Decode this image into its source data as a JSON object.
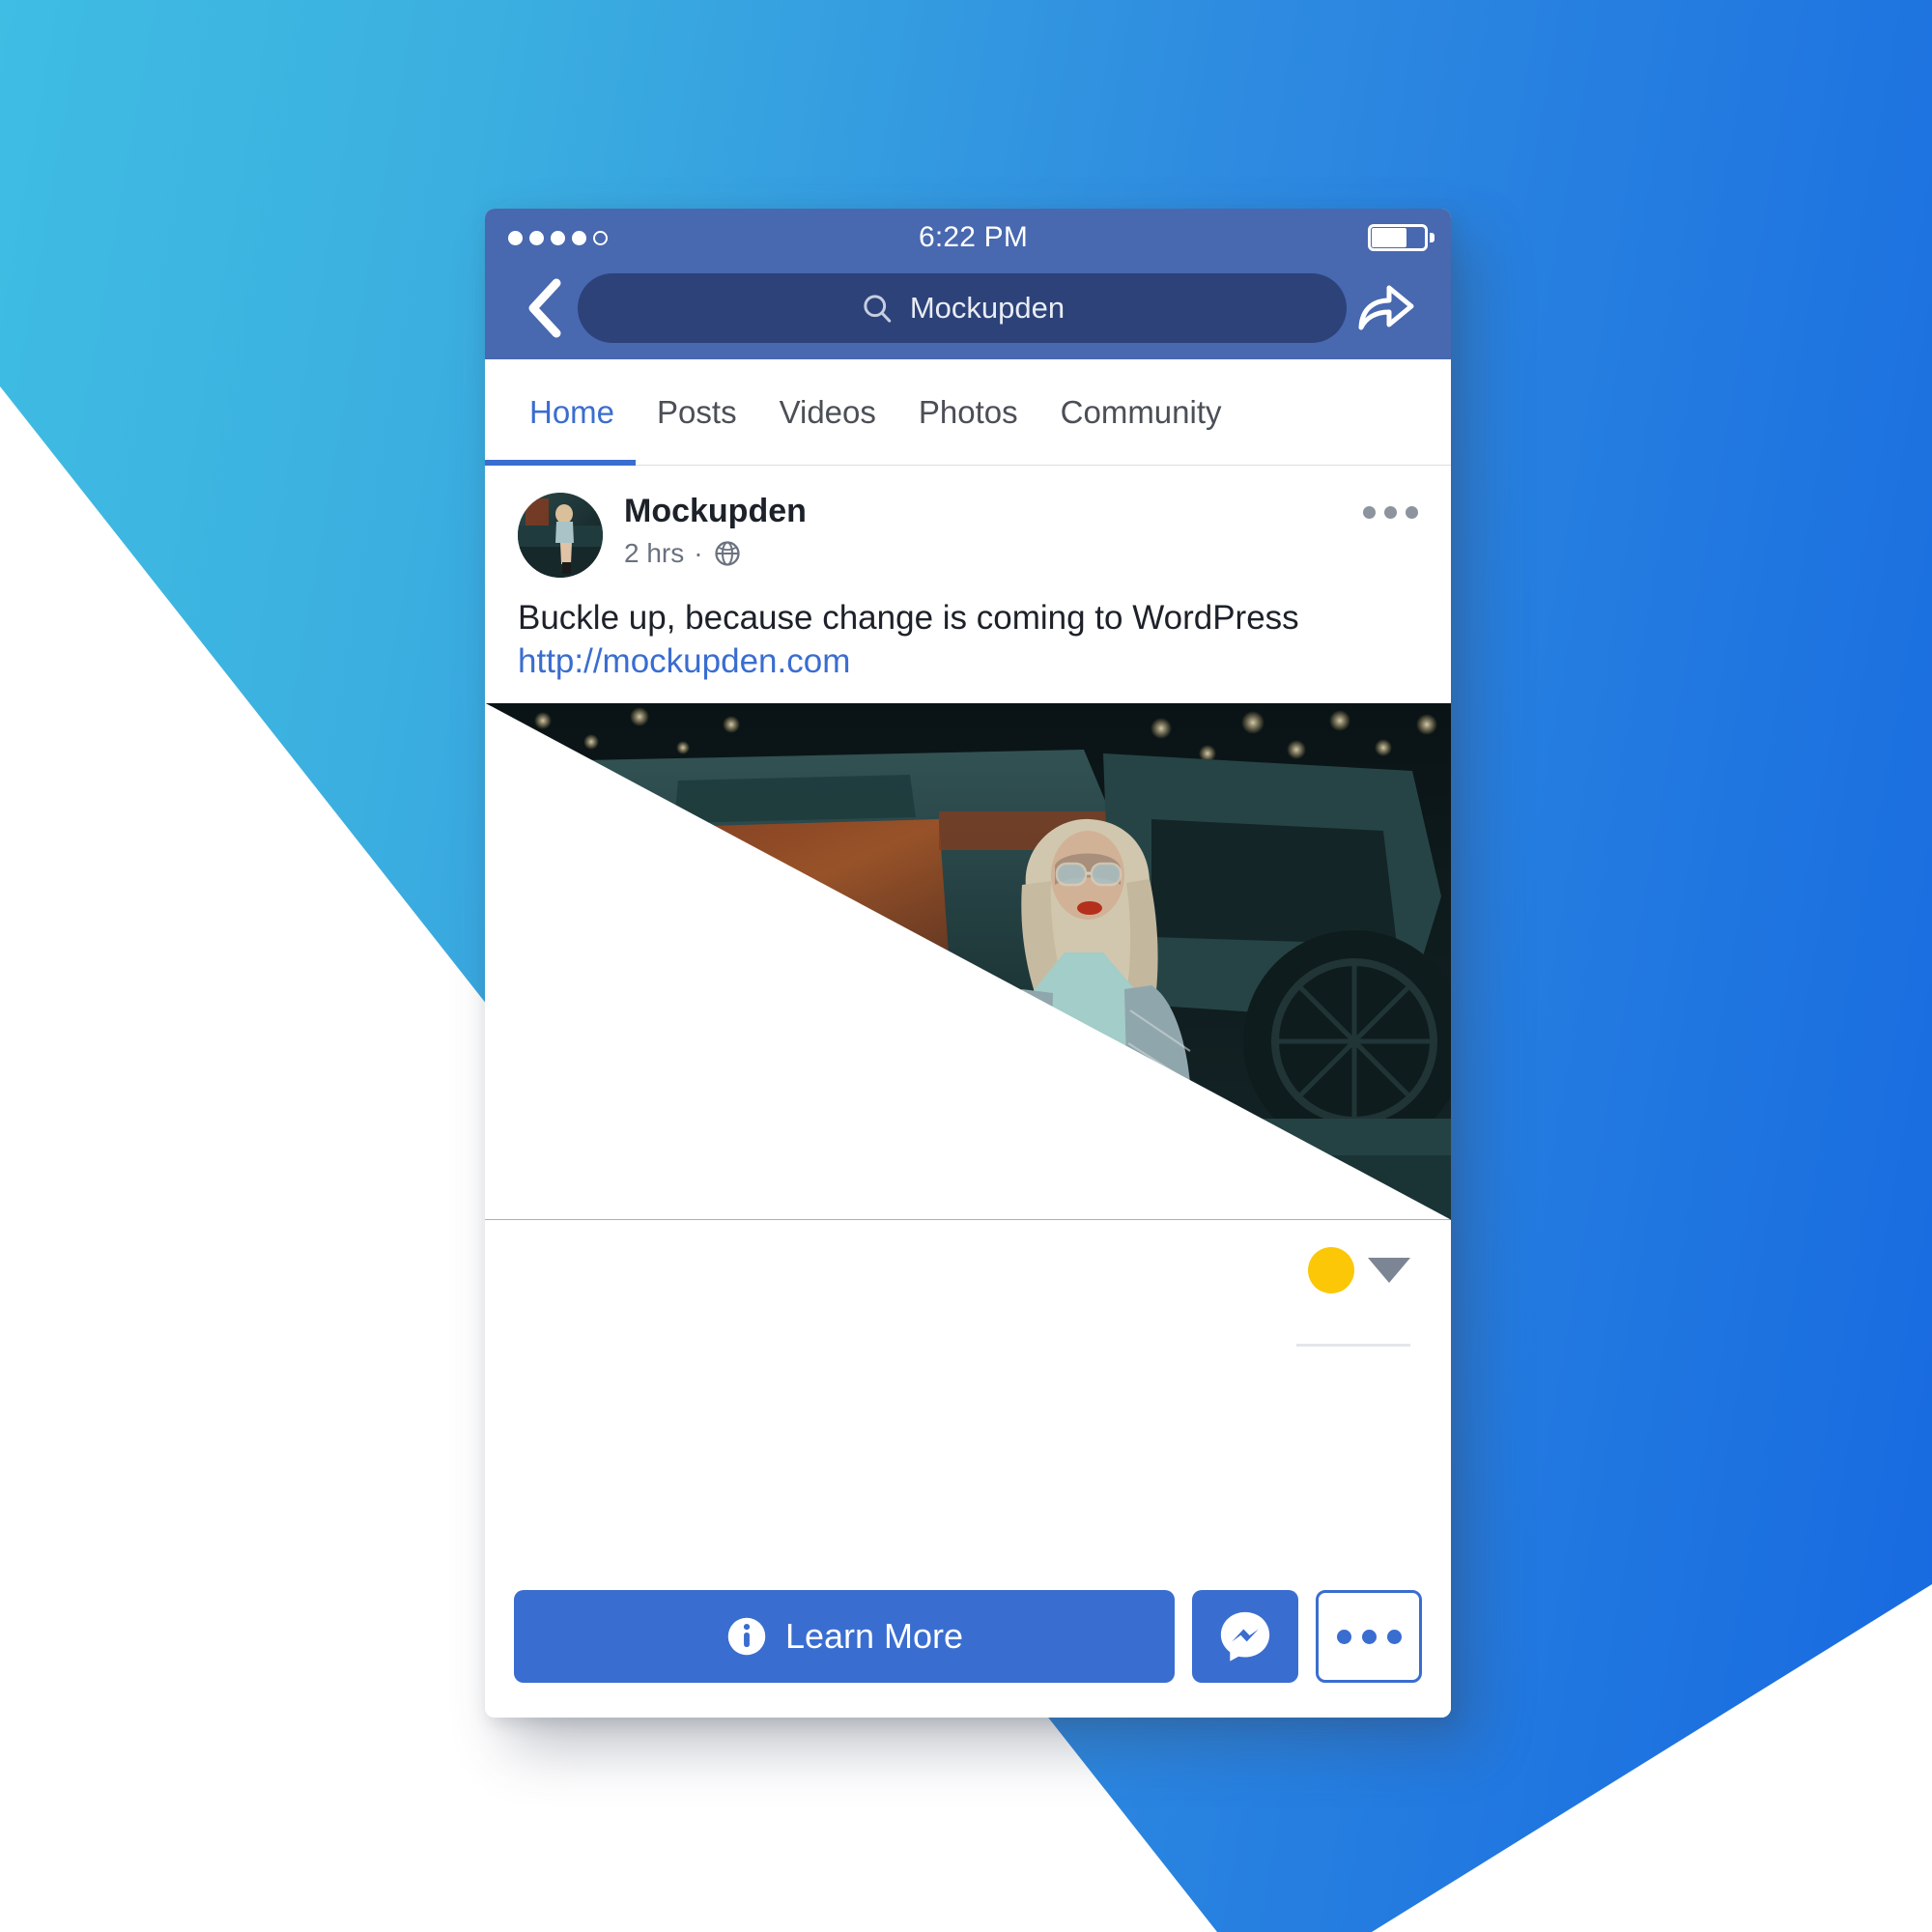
{
  "background": {
    "gradient_from": "#3FBDE3",
    "gradient_to": "#1769E0",
    "wedge_color": "#ffffff"
  },
  "phone": {
    "statusbar": {
      "time": "6:22 PM",
      "signal_dots_filled": 4,
      "signal_dots_empty": 1,
      "battery_level_pct": 62
    },
    "navbar": {
      "back_icon": "chevron-left-icon",
      "share_icon": "share-arrow-icon",
      "search": {
        "icon": "search-icon",
        "value": "Mockupden",
        "placeholder": "Search"
      }
    },
    "tabs": [
      {
        "label": "Home",
        "active": true
      },
      {
        "label": "Posts",
        "active": false
      },
      {
        "label": "Videos",
        "active": false
      },
      {
        "label": "Photos",
        "active": false
      },
      {
        "label": "Community",
        "active": false
      }
    ],
    "post": {
      "avatar_alt": "Mockupden page avatar",
      "page_name": "Mockupden",
      "timestamp": "2 hrs",
      "separator": "·",
      "privacy_icon": "globe-icon",
      "menu_icon": "ellipsis-icon",
      "body": "Buckle up, because change is coming to WordPress",
      "link": "http://mockupden.com",
      "photo_alt": "Woman in sunglasses seated by a rusty vintage car with bokeh lights",
      "reactions": {
        "emoji": "like-reaction-yellow",
        "emoji_color": "#FBC707",
        "caret_icon": "caret-down-icon"
      }
    },
    "actionbar": {
      "learn_more_label": "Learn More",
      "learn_more_icon": "info-icon",
      "messenger_icon": "messenger-icon",
      "more_icon": "ellipsis-icon"
    },
    "colors": {
      "fb_header": "#4868B0",
      "search_pill": "#2C4279",
      "accent": "#3A6DD0",
      "link": "#3A6DD0",
      "text_primary": "#1D2129",
      "text_muted": "#6A7180"
    }
  }
}
